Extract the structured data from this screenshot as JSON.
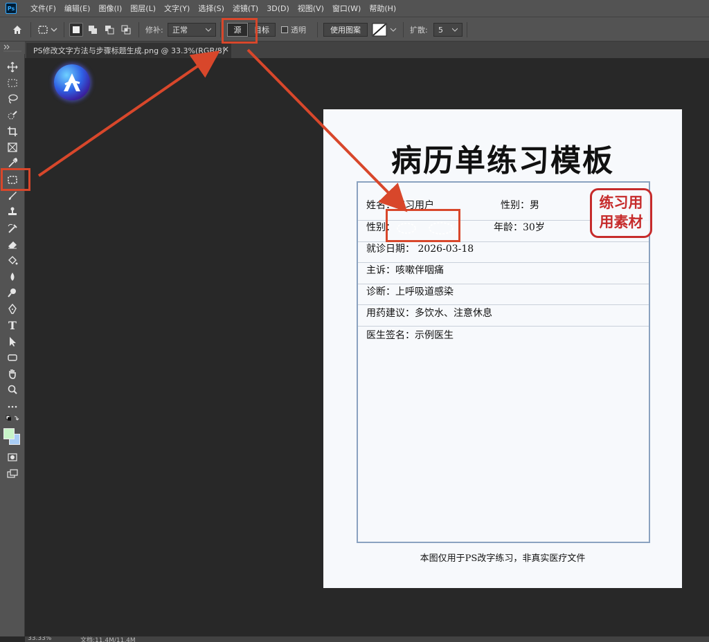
{
  "app": {
    "logo_text": "Ps"
  },
  "menu": [
    "文件(F)",
    "编辑(E)",
    "图像(I)",
    "图层(L)",
    "文字(Y)",
    "选择(S)",
    "滤镜(T)",
    "3D(D)",
    "视图(V)",
    "窗口(W)",
    "帮助(H)"
  ],
  "options_bar": {
    "patch_label": "修补:",
    "patch_mode": "正常",
    "source_label": "源",
    "target_label": "目标",
    "transparent_label": "透明",
    "use_pattern_label": "使用图案",
    "diffusion_label": "扩散:",
    "diffusion_value": "5"
  },
  "document_tab": {
    "title": "PS修改文字方法与步骤标题生成.png @ 33.3%(RGB/8)",
    "close": "×"
  },
  "status_bar": {
    "zoom": "33.33%",
    "doc_info": "文档:11.4M/11.4M"
  },
  "icons": {
    "home": "home-icon",
    "patch_tool": "patch-tool-icon",
    "move": "move-tool-icon",
    "marquee": "marquee-tool-icon",
    "lasso": "lasso-tool-icon",
    "quick_select": "quick-selection-icon",
    "crop": "crop-tool-icon",
    "frame": "frame-tool-icon",
    "eyedropper": "eyedropper-icon",
    "brush": "brush-tool-icon",
    "stamp": "clone-stamp-icon",
    "history_brush": "history-brush-icon",
    "eraser": "eraser-icon",
    "bucket": "paint-bucket-icon",
    "blur": "blur-tool-icon",
    "dodge": "dodge-tool-icon",
    "pen": "pen-tool-icon",
    "type": "type-tool-icon",
    "path_select": "path-selection-icon",
    "rectangle": "rectangle-tool-icon",
    "hand": "hand-tool-icon",
    "zoom": "zoom-tool-icon",
    "more": "more-tools-icon"
  },
  "colors": {
    "foreground": "#c8f5c8",
    "background": "#a9cdf5",
    "highlight": "#d8472b",
    "stamp": "#c62b2b"
  },
  "medical_record": {
    "title": "病历单练习模板",
    "name": "姓名：练习用户",
    "gender_top": "性别：男",
    "gender_row_label": "性别：",
    "age": "年龄：30岁",
    "visit_date": "就诊日期：  2026-03-18",
    "complaint": "主诉：咳嗽伴咽痛",
    "diagnosis": "诊断：上呼吸道感染",
    "advice": "用药建议：多饮水、注意休息",
    "doctor": "医生签名：示例医生",
    "stamp_line1": "练习用",
    "stamp_line2": "用素材",
    "note": "本图仅用于PS改字练习，非真实医疗文件"
  }
}
